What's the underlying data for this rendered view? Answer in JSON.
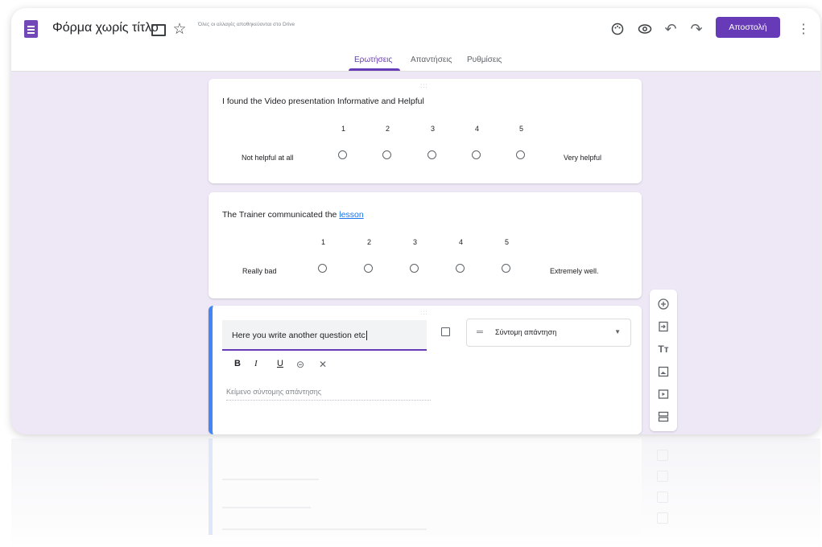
{
  "header": {
    "doc_title": "Φόρμα χωρίς τίτλο",
    "save_status": "Όλες οι αλλαγές αποθηκεύονται στο Drive",
    "send_label": "Αποστολή"
  },
  "tabs": [
    {
      "label": "Ερωτήσεις",
      "active": true
    },
    {
      "label": "Απαντήσεις",
      "active": false
    },
    {
      "label": "Ρυθμίσεις",
      "active": false
    }
  ],
  "questions": [
    {
      "title": "I found the Video presentation Informative and Helpful",
      "scale": [
        "1",
        "2",
        "3",
        "4",
        "5"
      ],
      "low_label": "Not helpful at all",
      "high_label": "Very helpful"
    },
    {
      "title_prefix": "The Trainer communicated the ",
      "title_link": "lesson",
      "scale": [
        "1",
        "2",
        "3",
        "4",
        "5"
      ],
      "low_label": "Really bad",
      "high_label": "Extremely well."
    }
  ],
  "editing_question": {
    "title": "Here you write another question etc",
    "type_label": "Σύντομη απάντηση",
    "answer_placeholder": "Κείμενο σύντομης απάντησης",
    "format_buttons": [
      "B",
      "I",
      "U"
    ]
  },
  "icons": [
    "forms-app-icon",
    "folder-icon",
    "star-icon",
    "palette-icon",
    "preview-icon",
    "undo-icon",
    "redo-icon",
    "more-icon",
    "image-icon",
    "short-answer-icon",
    "add-question-icon",
    "import-questions-icon",
    "add-title-icon",
    "add-image-icon",
    "add-video-icon",
    "add-section-icon"
  ],
  "colors": {
    "accent": "#673ab7",
    "background": "#ede7f6",
    "active_question_border": "#4285f4",
    "link": "#1a73e8"
  }
}
